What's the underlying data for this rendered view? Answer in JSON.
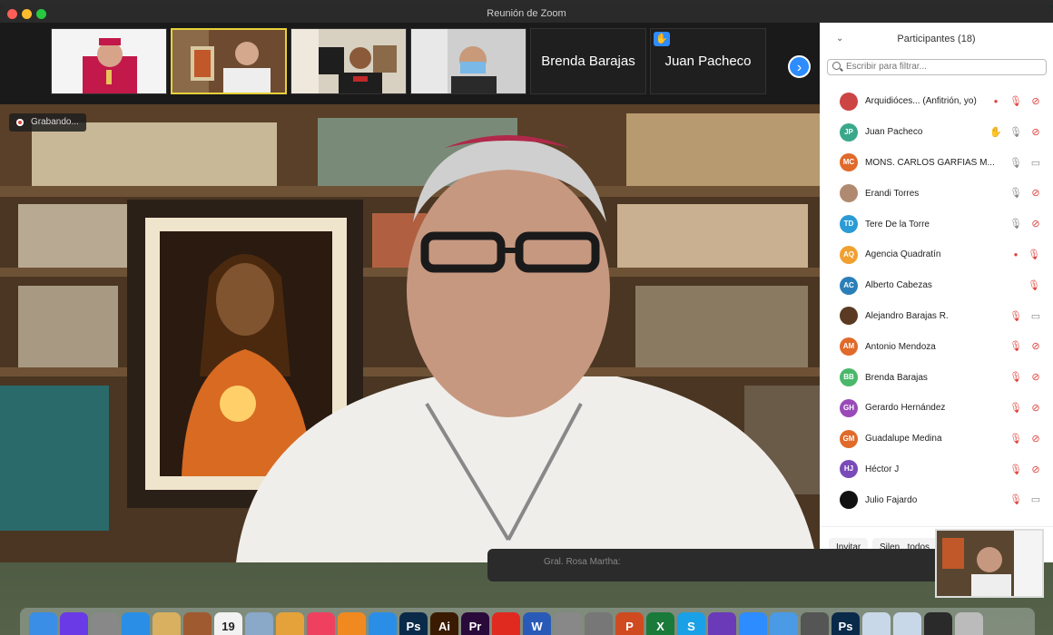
{
  "window": {
    "title": "Reunión de Zoom"
  },
  "thumbnails": [
    {
      "name": "",
      "kind": "video"
    },
    {
      "name": "",
      "kind": "video"
    },
    {
      "name": "",
      "kind": "video"
    },
    {
      "name": "",
      "kind": "video"
    },
    {
      "name": "Brenda Barajas",
      "kind": "label"
    },
    {
      "name": "Juan Pacheco",
      "kind": "label",
      "hand_raised": true
    }
  ],
  "recording": {
    "label": "Grabando..."
  },
  "participants_panel": {
    "title": "Participantes (18)",
    "search_placeholder": "Escribir para filtrar...",
    "participants": [
      {
        "initials": "",
        "name": "Arquidióces... (Anfitrión, yo)",
        "color": "#c44",
        "photo": true,
        "recording": true,
        "mic": "muted",
        "cam": "off"
      },
      {
        "initials": "JP",
        "name": "Juan Pacheco",
        "color": "#3aa88a",
        "hand": true,
        "mic": "on",
        "cam": "off"
      },
      {
        "initials": "MC",
        "name": "MONS. CARLOS GARFIAS M...",
        "color": "#e06a2a",
        "mic": "on",
        "cam": "on"
      },
      {
        "initials": "",
        "name": "Erandi Torres",
        "color": "#b08a70",
        "photo": true,
        "mic": "on",
        "cam": "off"
      },
      {
        "initials": "TD",
        "name": "Tere De la Torre",
        "color": "#2a9bd6",
        "mic": "on",
        "cam": "off"
      },
      {
        "initials": "AQ",
        "name": "Agencia Quadratín",
        "color": "#f0a030",
        "recording": true,
        "mic": "muted"
      },
      {
        "initials": "AC",
        "name": "Alberto Cabezas",
        "color": "#2a7fb8",
        "mic": "muted"
      },
      {
        "initials": "",
        "name": "Alejandro Barajas R.",
        "color": "#5a3a22",
        "photo": true,
        "mic": "muted",
        "cam": "on"
      },
      {
        "initials": "AM",
        "name": "Antonio Mendoza",
        "color": "#e06a2a",
        "mic": "muted",
        "cam": "off"
      },
      {
        "initials": "BB",
        "name": "Brenda Barajas",
        "color": "#49b86a",
        "mic": "muted",
        "cam": "off"
      },
      {
        "initials": "GH",
        "name": "Gerardo Hernández",
        "color": "#9a4ab8",
        "mic": "muted",
        "cam": "off"
      },
      {
        "initials": "GM",
        "name": "Guadalupe Medina",
        "color": "#e06a2a",
        "mic": "muted",
        "cam": "off"
      },
      {
        "initials": "HJ",
        "name": "Héctor J",
        "color": "#7a4ab8",
        "mic": "muted",
        "cam": "off"
      },
      {
        "initials": "",
        "name": "Julio Fajardo",
        "color": "#111",
        "photo": true,
        "mic": "muted",
        "cam": "on"
      }
    ],
    "footer": {
      "invite": "Invitar",
      "mute_all": "Silen...todos"
    }
  },
  "behind_window": {
    "text": "Gral. Rosa Martha:"
  },
  "dock": {
    "apps": [
      {
        "name": "finder-icon",
        "label": "",
        "color": "#3a8ee6"
      },
      {
        "name": "siri-icon",
        "label": "",
        "color": "#6a3ae6"
      },
      {
        "name": "launchpad-icon",
        "label": "",
        "color": "#888"
      },
      {
        "name": "safari-icon",
        "label": "",
        "color": "#2a8ee6"
      },
      {
        "name": "notes-icon",
        "label": "",
        "color": "#d8b060"
      },
      {
        "name": "books-stack-icon",
        "label": "",
        "color": "#a05a30"
      },
      {
        "name": "calendar-icon",
        "label": "19",
        "color": "#f2f2f2"
      },
      {
        "name": "preview-icon",
        "label": "",
        "color": "#8aa8c8"
      },
      {
        "name": "photos-icon",
        "label": "",
        "color": "#e6a23a"
      },
      {
        "name": "music-icon",
        "label": "",
        "color": "#f04060"
      },
      {
        "name": "books-icon",
        "label": "",
        "color": "#f08a20"
      },
      {
        "name": "app-store-icon",
        "label": "",
        "color": "#2a8ee6"
      },
      {
        "name": "photoshop-icon",
        "label": "Ps",
        "color": "#0a2a4a"
      },
      {
        "name": "illustrator-icon",
        "label": "Ai",
        "color": "#3a1a00"
      },
      {
        "name": "premiere-icon",
        "label": "Pr",
        "color": "#2a0a3a"
      },
      {
        "name": "acrobat-icon",
        "label": "",
        "color": "#e02a20"
      },
      {
        "name": "word-icon",
        "label": "W",
        "color": "#2a5ab8"
      },
      {
        "name": "image-capture-icon",
        "label": "",
        "color": "#888"
      },
      {
        "name": "system-preferences-icon",
        "label": "",
        "color": "#777"
      },
      {
        "name": "powerpoint-icon",
        "label": "P",
        "color": "#d04a20"
      },
      {
        "name": "excel-icon",
        "label": "X",
        "color": "#1a7a3a"
      },
      {
        "name": "skype-icon",
        "label": "S",
        "color": "#1aa0e6"
      },
      {
        "name": "imovie-icon",
        "label": "",
        "color": "#6a3ab8"
      },
      {
        "name": "zoom-icon",
        "label": "",
        "color": "#2d8cff"
      },
      {
        "name": "icloud-icon",
        "label": "",
        "color": "#4a9ae6"
      },
      {
        "name": "tool-icon",
        "label": "",
        "color": "#555"
      },
      {
        "name": "photoshop-2-icon",
        "label": "Ps",
        "color": "#0a2a4a"
      },
      {
        "name": "folder-1-icon",
        "label": "",
        "color": "#c8d8e8"
      },
      {
        "name": "folder-2-icon",
        "label": "",
        "color": "#c8d8e8"
      },
      {
        "name": "folder-3-icon",
        "label": "",
        "color": "#2a2a2a"
      },
      {
        "name": "trash-icon",
        "label": "",
        "color": "#bbb"
      }
    ]
  }
}
